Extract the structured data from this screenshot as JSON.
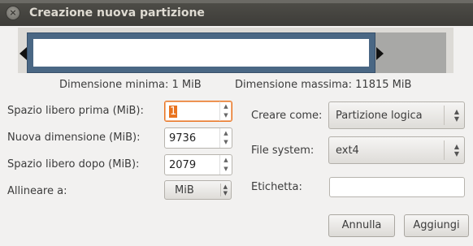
{
  "window": {
    "title": "Creazione nuova partizione",
    "close_glyph": "×"
  },
  "resizer": {
    "min_label": "Dimensione minima: 1 MiB",
    "max_label": "Dimensione massima: 11815 MiB"
  },
  "left_form": {
    "free_before": {
      "label": "Spazio libero prima (MiB):",
      "value": "1"
    },
    "new_size": {
      "label": "Nuova dimensione (MiB):",
      "value": "9736"
    },
    "free_after": {
      "label": "Spazio libero dopo (MiB):",
      "value": "2079"
    },
    "align": {
      "label": "Allineare a:",
      "value": "MiB"
    }
  },
  "right_form": {
    "create_as": {
      "label": "Creare come:",
      "value": "Partizione logica"
    },
    "filesystem": {
      "label": "File system:",
      "value": "ext4"
    },
    "label_field": {
      "label": "Etichetta:",
      "value": ""
    }
  },
  "buttons": {
    "cancel": "Annulla",
    "add": "Aggiungi"
  },
  "colors": {
    "titlebar": "#3d3c38",
    "partition_bar": "#4a6784",
    "focus": "#e9731f"
  }
}
